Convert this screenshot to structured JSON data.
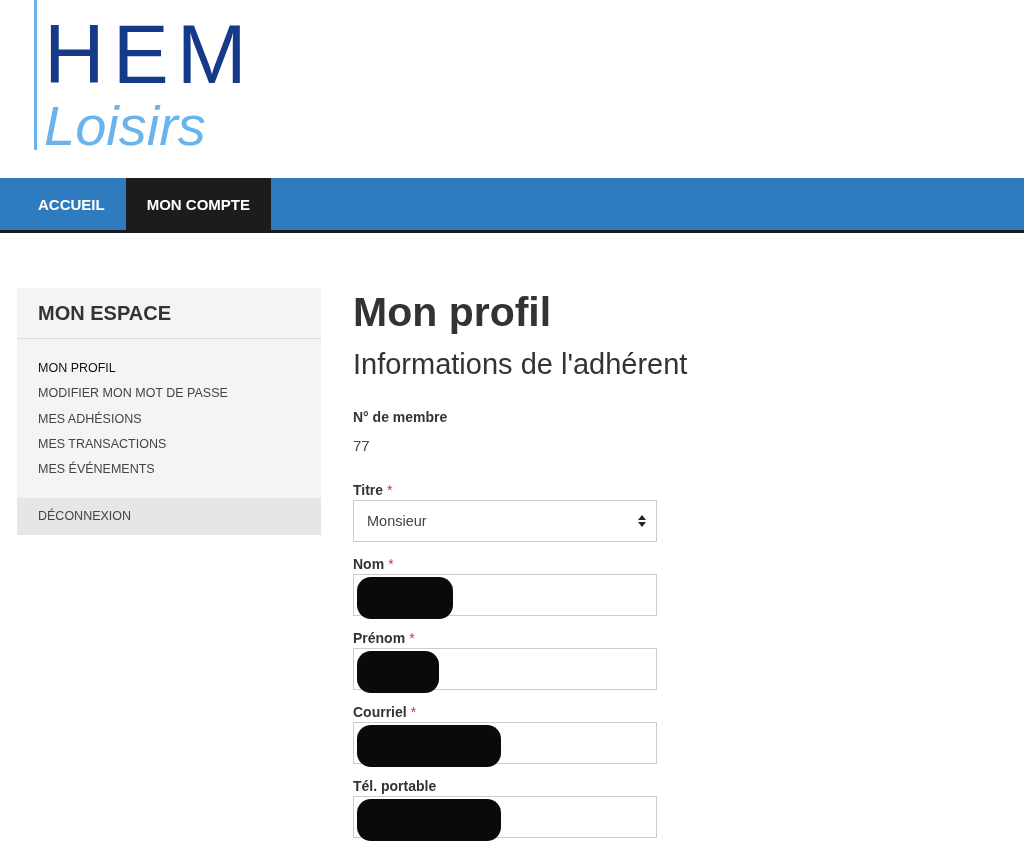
{
  "logo": {
    "line_1": "HEM",
    "line_2": "Loisirs"
  },
  "nav": [
    {
      "label": "ACCUEIL",
      "selected": false
    },
    {
      "label": "MON COMPTE",
      "selected": true
    }
  ],
  "sidebar": {
    "title": "MON ESPACE",
    "items": [
      {
        "label": "MON PROFIL",
        "selected": true
      },
      {
        "label": "MODIFIER MON MOT DE PASSE",
        "selected": false
      },
      {
        "label": "MES ADHÉSIONS",
        "selected": false
      },
      {
        "label": "MES TRANSACTIONS",
        "selected": false
      },
      {
        "label": "MES ÉVÉNEMENTS",
        "selected": false
      }
    ],
    "logout": "DÉCONNEXION"
  },
  "main": {
    "title": "Mon profil",
    "subtitle": "Informations de l'adhérent",
    "member": {
      "label": "N° de membre",
      "value": "77"
    },
    "fields": [
      {
        "kind": "select",
        "label": "Titre",
        "required_mark": "*",
        "value": "Monsieur"
      },
      {
        "kind": "text",
        "label": "Nom",
        "required_mark": "*",
        "redacted": true
      },
      {
        "kind": "text",
        "label": "Prénom",
        "required_mark": "*",
        "redacted": true
      },
      {
        "kind": "text",
        "label": "Courriel",
        "required_mark": "*",
        "redacted": true
      },
      {
        "kind": "text",
        "label": "Tél. portable",
        "redacted": true
      }
    ]
  }
}
